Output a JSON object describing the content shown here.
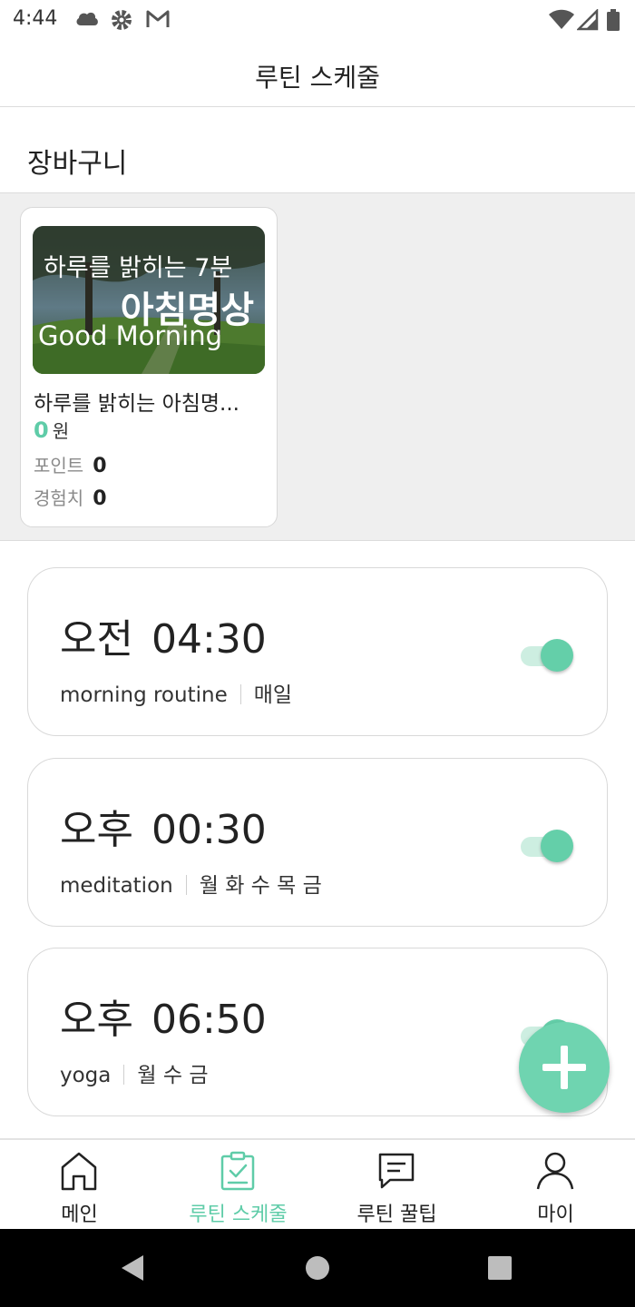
{
  "status_bar": {
    "time": "4:44",
    "left_icons": [
      "cloud-icon",
      "gear-icon",
      "gmail-icon"
    ],
    "right_icons": [
      "wifi-icon",
      "signal-icon",
      "battery-icon"
    ]
  },
  "header": {
    "title": "루틴 스케줄"
  },
  "cart": {
    "title": "장바구니",
    "items": [
      {
        "thumb_line1": "하루를 밝히는 7분",
        "thumb_line2": "아침명상",
        "thumb_line3": "Good Morning",
        "name": "하루를 밝히는 아침명...",
        "price": "0",
        "price_unit": "원",
        "points_label": "포인트",
        "points": "0",
        "exp_label": "경험치",
        "exp": "0"
      }
    ]
  },
  "routines": [
    {
      "ampm": "오전",
      "time": "04:30",
      "name": "morning routine",
      "days": "매일",
      "enabled": true
    },
    {
      "ampm": "오후",
      "time": "00:30",
      "name": "meditation",
      "days": "월 화 수 목 금",
      "enabled": true
    },
    {
      "ampm": "오후",
      "time": "06:50",
      "name": "yoga",
      "days": "월 수 금",
      "enabled": true
    }
  ],
  "fab": {
    "icon": "plus-icon"
  },
  "bottom_nav": {
    "items": [
      {
        "label": "메인",
        "icon": "home-icon",
        "active": false
      },
      {
        "label": "루틴 스케줄",
        "icon": "clipboard-check-icon",
        "active": true
      },
      {
        "label": "루틴 꿀팁",
        "icon": "chat-icon",
        "active": false
      },
      {
        "label": "마이",
        "icon": "user-icon",
        "active": false
      }
    ]
  },
  "colors": {
    "accent": "#5fcca8",
    "fab": "#6fd4b0",
    "toggle_track": "#cdeee1",
    "cart_bg": "#efefef"
  }
}
